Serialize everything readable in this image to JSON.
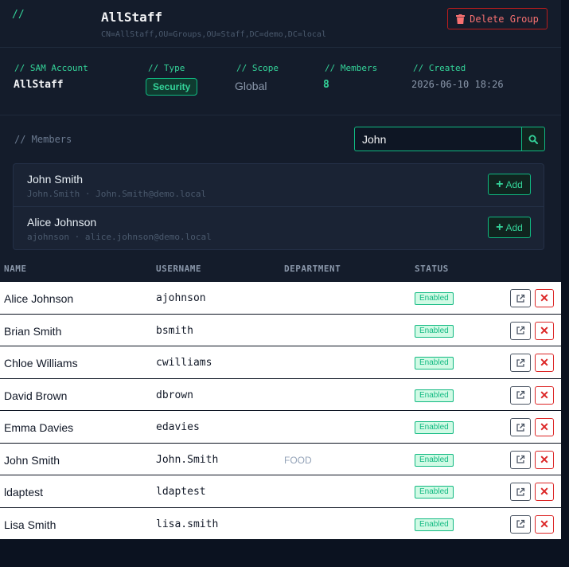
{
  "header": {
    "slash": "//",
    "title": "AllStaff",
    "dn": "CN=AllStaff,OU=Groups,OU=Staff,DC=demo,DC=local",
    "delete_label": "Delete Group"
  },
  "info": {
    "sam_label": "// SAM Account",
    "sam_value": "AllStaff",
    "type_label": "// Type",
    "type_value": "Security",
    "scope_label": "// Scope",
    "scope_value": "Global",
    "members_label": "// Members",
    "members_value": "8",
    "created_label": "// Created",
    "created_value": "2026-06-10 18:26"
  },
  "members": {
    "label": "// Members",
    "search_value": "John",
    "results": [
      {
        "name": "John Smith",
        "sub": "John.Smith · John.Smith@demo.local",
        "add_label": "Add"
      },
      {
        "name": "Alice Johnson",
        "sub": "ajohnson · alice.johnson@demo.local",
        "add_label": "Add"
      }
    ]
  },
  "table": {
    "headers": {
      "name": "NAME",
      "username": "USERNAME",
      "department": "DEPARTMENT",
      "status": "STATUS"
    },
    "rows": [
      {
        "name": "Alice Johnson",
        "username": "ajohnson",
        "department": "",
        "status": "Enabled"
      },
      {
        "name": "Brian Smith",
        "username": "bsmith",
        "department": "",
        "status": "Enabled"
      },
      {
        "name": "Chloe Williams",
        "username": "cwilliams",
        "department": "",
        "status": "Enabled"
      },
      {
        "name": "David Brown",
        "username": "dbrown",
        "department": "",
        "status": "Enabled"
      },
      {
        "name": "Emma Davies",
        "username": "edavies",
        "department": "",
        "status": "Enabled"
      },
      {
        "name": "John Smith",
        "username": "John.Smith",
        "department": "FOOD",
        "status": "Enabled"
      },
      {
        "name": "ldaptest",
        "username": "ldaptest",
        "department": "",
        "status": "Enabled"
      },
      {
        "name": "Lisa Smith",
        "username": "lisa.smith",
        "department": "",
        "status": "Enabled"
      }
    ],
    "remove_glyph": "✕"
  },
  "colors": {
    "accent": "#34d399",
    "danger": "#f87171",
    "background": "#0b1220",
    "panel": "#141c2b"
  },
  "icons": {
    "delete": "trash-icon",
    "search": "search-icon",
    "add": "plus-icon",
    "open": "external-link-icon",
    "remove": "close-icon"
  }
}
